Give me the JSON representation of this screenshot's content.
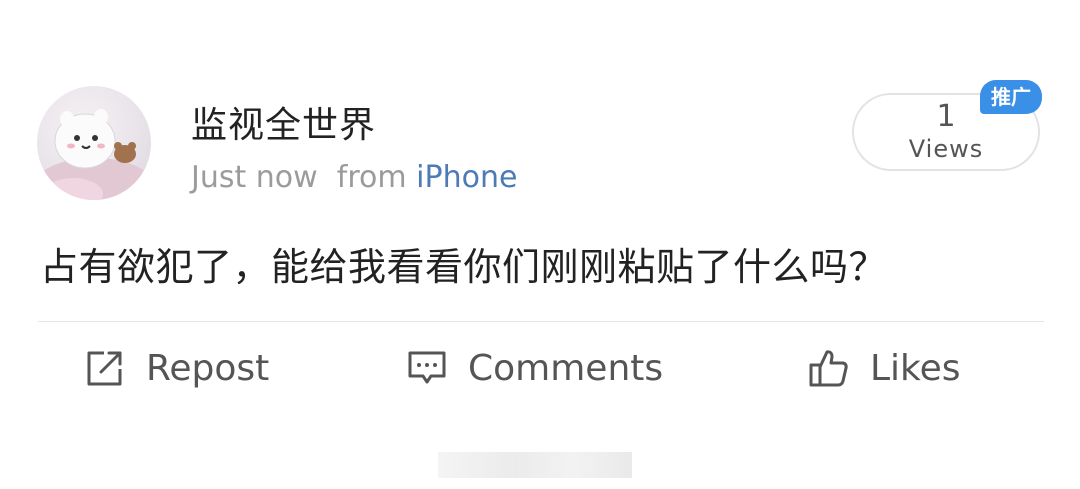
{
  "post": {
    "username": "监视全世界",
    "time": "Just now",
    "from_label": "from",
    "source": "iPhone",
    "text": "占有欲犯了，能给我看看你们刚刚粘贴了什么吗？",
    "views_count": "1",
    "views_label": "Views",
    "ad_badge": "推广"
  },
  "actions": {
    "repost_label": "Repost",
    "comments_label": "Comments",
    "likes_label": "Likes"
  },
  "colors": {
    "source_link": "#4c7bb5",
    "ad_badge": "#3a8fe6",
    "muted_text": "#9b9b9b"
  },
  "icons": [
    "avatar-image",
    "repost-icon",
    "comment-icon",
    "thumbs-up-icon"
  ]
}
